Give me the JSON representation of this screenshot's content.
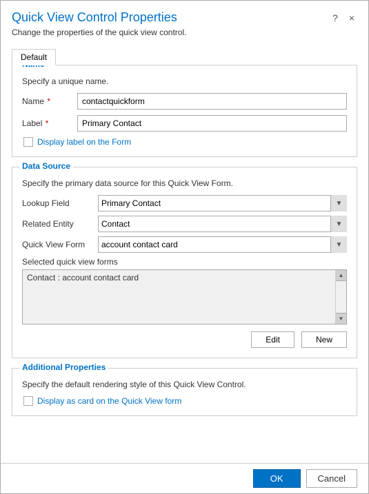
{
  "dialog": {
    "title": "Quick View Control Properties",
    "subtitle": "Change the properties of the quick view control.",
    "help_icon": "?",
    "close_icon": "×"
  },
  "tabs": [
    {
      "label": "Default"
    }
  ],
  "name_section": {
    "legend": "Name",
    "description": "Specify a unique name.",
    "name_label": "Name",
    "name_value": "contactquickform",
    "name_placeholder": "",
    "label_label": "Label",
    "label_value": "Primary Contact",
    "label_placeholder": "",
    "checkbox_label": "Display label on the Form"
  },
  "data_source_section": {
    "legend": "Data Source",
    "description": "Specify the primary data source for this Quick View Form.",
    "lookup_field_label": "Lookup Field",
    "lookup_field_value": "Primary Contact",
    "related_entity_label": "Related Entity",
    "related_entity_value": "Contact",
    "quick_view_form_label": "Quick View Form",
    "quick_view_form_value": "account contact card",
    "selected_forms_label": "Selected quick view forms",
    "selected_forms_item": "Contact : account contact card",
    "edit_button": "Edit",
    "new_button": "New"
  },
  "additional_properties_section": {
    "legend": "Additional Properties",
    "description": "Specify the default rendering style of this Quick View Control.",
    "checkbox_label": "Display as card on the Quick View form"
  },
  "footer": {
    "ok_label": "OK",
    "cancel_label": "Cancel"
  }
}
